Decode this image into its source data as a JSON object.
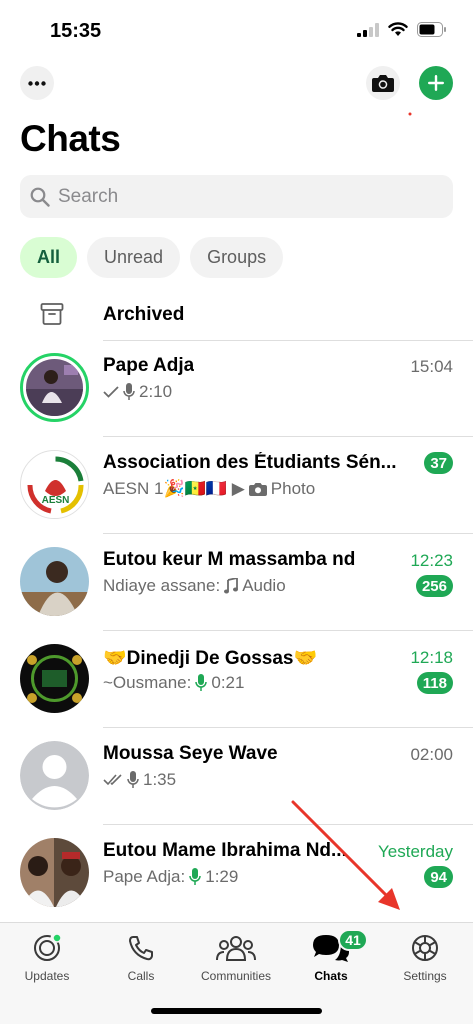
{
  "status_bar": {
    "time": "15:35"
  },
  "header": {
    "title": "Chats"
  },
  "search": {
    "placeholder": "Search"
  },
  "filters": [
    {
      "label": "All",
      "active": true
    },
    {
      "label": "Unread",
      "active": false
    },
    {
      "label": "Groups",
      "active": false
    }
  ],
  "archived": {
    "label": "Archived"
  },
  "chats": [
    {
      "name": "Pape Adja",
      "preview": "2:10",
      "time": "15:04",
      "unread_count": ""
    },
    {
      "name": "Association des Étudiants Sén...",
      "preview_prefix": "AESN 1🎉🇸🇳🇫🇷 ▶",
      "preview": "Photo",
      "time": "",
      "unread_count": "37"
    },
    {
      "name": "Eutou keur  M massamba nd",
      "preview_prefix": "Ndiaye assane:",
      "preview": "Audio",
      "time": "12:23",
      "unread_count": "256"
    },
    {
      "name": "🤝Dinedji De Gossas🤝",
      "preview_prefix": "~Ousmane:",
      "preview": "0:21",
      "time": "12:18",
      "unread_count": "118"
    },
    {
      "name": "Moussa Seye Wave",
      "preview": "1:35",
      "time": "02:00",
      "unread_count": ""
    },
    {
      "name": "Eutou Mame Ibrahima Nd...",
      "preview_prefix": "Pape Adja:",
      "preview": "1:29",
      "time": "Yesterday",
      "unread_count": "94"
    }
  ],
  "tab_bar": {
    "tabs": [
      {
        "label": "Updates"
      },
      {
        "label": "Calls"
      },
      {
        "label": "Communities"
      },
      {
        "label": "Chats",
        "badge": "41"
      },
      {
        "label": "Settings"
      }
    ]
  },
  "colors": {
    "accent": "#1fa855",
    "chip_active_bg": "#d9fdd3",
    "annotation": "#e8352a"
  },
  "icons": [
    "more-icon",
    "camera-icon",
    "plus-icon",
    "search-icon",
    "archive-icon",
    "mic-icon",
    "music-icon",
    "photo-icon",
    "updates-icon",
    "calls-icon",
    "communities-icon",
    "chats-icon",
    "settings-icon"
  ]
}
